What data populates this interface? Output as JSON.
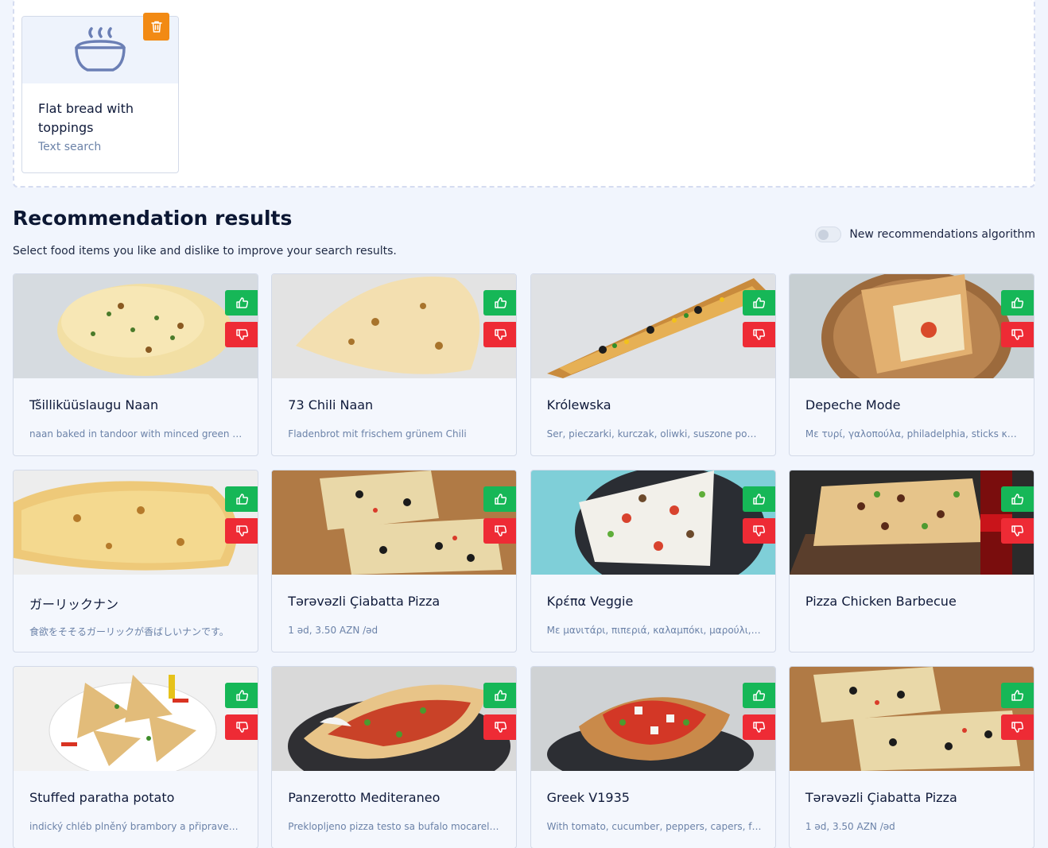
{
  "query": {
    "title": "Flat bread with toppings",
    "subtitle": "Text search",
    "icon": "bowl-steam-icon",
    "delete_icon": "trash-icon"
  },
  "results": {
    "heading": "Recommendation results",
    "subtext": "Select food items you like and dislike to improve your search results.",
    "toggle_label": "New recommendations algorithm",
    "toggle_on": false
  },
  "colors": {
    "like": "#16b757",
    "dislike": "#ee2b35",
    "delete": "#f28a14"
  },
  "items": [
    {
      "title": "Tšilliküüslaugu Naan",
      "desc": "naan baked in tandoor with minced green chilli and garlic"
    },
    {
      "title": "73 Chili Naan",
      "desc": "Fladenbrot mit frischem grünem Chili"
    },
    {
      "title": "Królewska",
      "desc": "Ser, pieczarki, kurczak, oliwki, suszone pomidory, kukurydza"
    },
    {
      "title": "Depeche Mode",
      "desc": "Με τυρί, γαλοπούλα, philadelphia, sticks καβουριού"
    },
    {
      "title": "ガーリックナン",
      "desc": "食欲をそそるガーリックが香ばしいナンです。"
    },
    {
      "title": "Tərəvəzli Çiabatta Pizza",
      "desc": "1 əd, 3.50 AZN /əd"
    },
    {
      "title": "Κρέπα Veggie",
      "desc": "Με μανιτάρι, πιπεριά, καλαμπόκι, μαρούλι, ντομάτα"
    },
    {
      "title": "Pizza Chicken Barbecue",
      "desc": ""
    },
    {
      "title": "Stuffed paratha potato",
      "desc": "indický chléb plněný brambory a připravený na pánvi"
    },
    {
      "title": "Panzerotto Mediteraneo",
      "desc": "Preklopljeno pizza testo sa bufalo mocarelom i paradajzom"
    },
    {
      "title": "Greek V1935",
      "desc": "With tomato, cucumber, peppers, capers, feta and olives"
    },
    {
      "title": "Tərəvəzli Çiabatta Pizza",
      "desc": "1 əd, 3.50 AZN /əd"
    }
  ]
}
